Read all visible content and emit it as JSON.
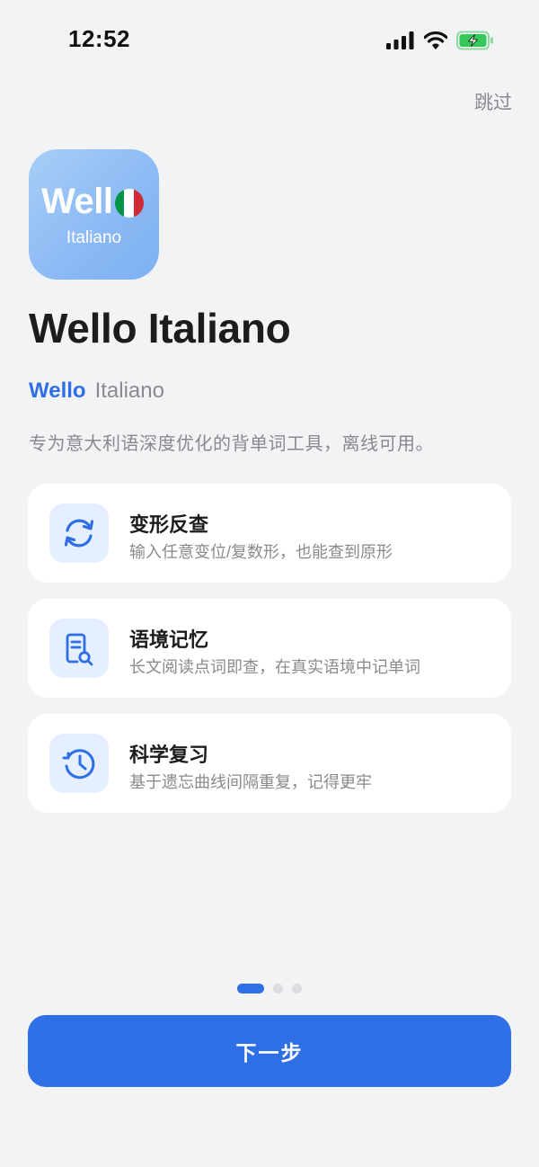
{
  "status_bar": {
    "time": "12:52",
    "icons": [
      "signal-icon",
      "wifi-icon",
      "battery-charging-icon"
    ]
  },
  "skip_label": "跳过",
  "app_icon": {
    "wordmark": "Well",
    "subtitle": "Italiano",
    "flag_colors": [
      "#009246",
      "#ffffff",
      "#ce2b37"
    ],
    "gradient": [
      "#a9cdf7",
      "#7cb1f3"
    ]
  },
  "title": "Wello Italiano",
  "subtitle": {
    "brand": "Wello",
    "language": "Italiano"
  },
  "tagline": "专为意大利语深度优化的背单词工具，离线可用。",
  "features": [
    {
      "icon": "refresh-icon",
      "title": "变形反查",
      "desc": "输入任意变位/复数形，也能查到原形"
    },
    {
      "icon": "document-search-icon",
      "title": "语境记忆",
      "desc": "长文阅读点词即查，在真实语境中记单词"
    },
    {
      "icon": "history-clock-icon",
      "title": "科学复习",
      "desc": "基于遗忘曲线间隔重复，记得更牢"
    }
  ],
  "pagination": {
    "current": 1,
    "total": 3
  },
  "next_button": "下一步",
  "colors": {
    "accent": "#2f6fe6",
    "background": "#f2f3f5",
    "muted_text": "#8a8a8e",
    "icon_tile": "#e6effd",
    "battery": "#35c759"
  }
}
